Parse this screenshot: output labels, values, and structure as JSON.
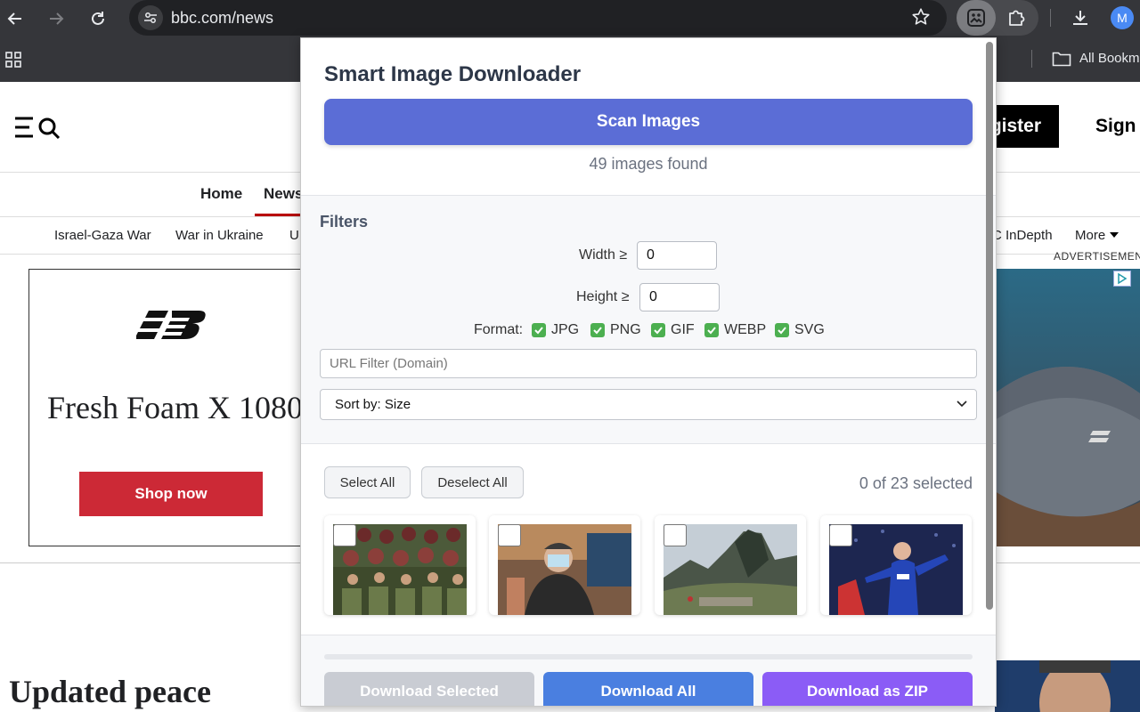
{
  "browser": {
    "url": "bbc.com/news",
    "avatar_letter": "M",
    "bookmark_label": "All Bookm"
  },
  "bbc": {
    "register_label": "gister",
    "sign_label": "Sign",
    "nav": {
      "home": "Home",
      "news": "News"
    },
    "subnav": [
      "Israel-Gaza War",
      "War in Ukraine",
      "U",
      "C InDepth",
      "More"
    ],
    "advertisement_label": "ADVERTISEMEN",
    "ad_left": {
      "title": "Fresh Foam X 1080",
      "cta": "Shop now"
    },
    "headline": "Updated peace"
  },
  "popup": {
    "title": "Smart Image Downloader",
    "scan_button": "Scan Images",
    "found_text": "49 images found",
    "filters": {
      "title": "Filters",
      "width_label": "Width ≥",
      "width_value": "0",
      "height_label": "Height ≥",
      "height_value": "0",
      "format_label": "Format:",
      "formats": [
        {
          "label": "JPG",
          "checked": true
        },
        {
          "label": "PNG",
          "checked": true
        },
        {
          "label": "GIF",
          "checked": true
        },
        {
          "label": "WEBP",
          "checked": true
        },
        {
          "label": "SVG",
          "checked": true
        }
      ],
      "url_placeholder": "URL Filter (Domain)",
      "sort_value": "Sort by: Size"
    },
    "select_all": "Select All",
    "deselect_all": "Deselect All",
    "selected_count": "0 of 23 selected",
    "download_selected": "Download Selected",
    "download_all": "Download All",
    "download_zip": "Download as ZIP",
    "colors": {
      "scan_button": "#5b6dd6",
      "download_all": "#4a7fe0",
      "download_zip": "#8b5cf6",
      "download_selected_disabled": "#c9ccd3",
      "checkbox_checked": "#4caf50"
    }
  }
}
